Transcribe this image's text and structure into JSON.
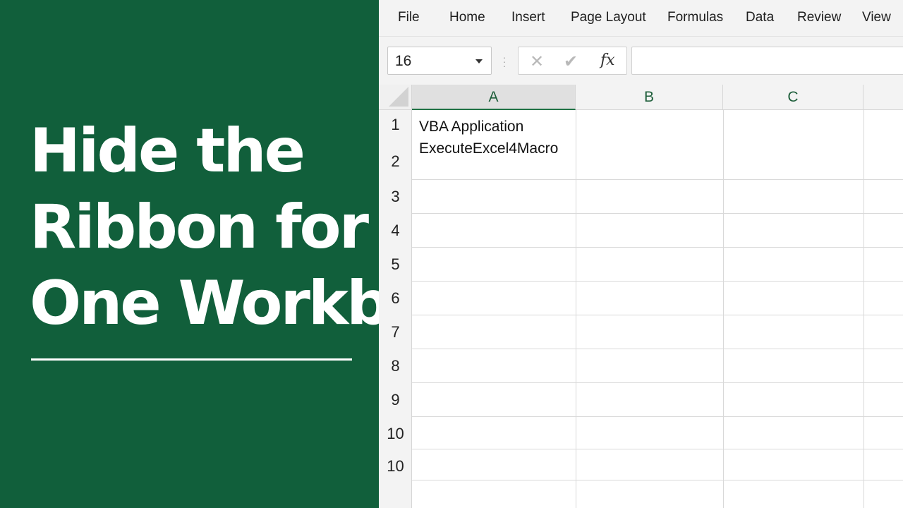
{
  "title": {
    "lines": [
      "Hide the",
      "Ribbon for",
      "One Workbook"
    ]
  },
  "menu": {
    "items": [
      "File",
      "Home",
      "Insert",
      "Page Layout",
      "Formulas",
      "Data",
      "Review",
      "View"
    ]
  },
  "formula_bar": {
    "name_box_value": "16",
    "fx_label": "fx",
    "formula_value": "",
    "cancel_icon": "close-icon",
    "enter_icon": "check-icon"
  },
  "grid": {
    "columns": [
      "A",
      "B",
      "C"
    ],
    "rows": [
      "1",
      "2",
      "3",
      "4",
      "5",
      "6",
      "7",
      "8",
      "9",
      "10",
      "10"
    ],
    "cell_A1_lines": [
      "VBA Application",
      "ExecuteExcel4Macro"
    ]
  },
  "colors": {
    "panel_green": "#115f3b",
    "excel_green": "#217346"
  }
}
